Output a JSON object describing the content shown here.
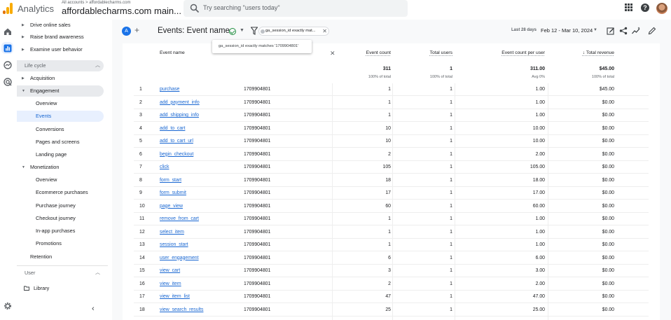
{
  "topbar": {
    "app_name": "Analytics",
    "account_breadcrumb": "All accounts > affordablecharms.com",
    "account_name": "affordablecharms.com main...",
    "search_placeholder": "Try searching \"users today\"",
    "icons": [
      "apps-grid-icon",
      "help-icon",
      "account-avatar"
    ]
  },
  "rail": {
    "icons": [
      "home-icon",
      "reports-icon",
      "explore-icon",
      "advertising-icon",
      "admin-gear-icon"
    ]
  },
  "sidebar": {
    "top_items": [
      "Drive online sales",
      "Raise brand awareness",
      "Examine user behavior"
    ],
    "lifecycle_label": "Life cycle",
    "acquisition": "Acquisition",
    "engagement": "Engagement",
    "engagement_children": [
      "Overview",
      "Events",
      "Conversions",
      "Pages and screens",
      "Landing page"
    ],
    "monetization": "Monetization",
    "monetization_children": [
      "Overview",
      "Ecommerce purchases",
      "Purchase journey",
      "Checkout journey",
      "In-app purchases",
      "Promotions"
    ],
    "retention": "Retention",
    "user_label": "User",
    "library": "Library",
    "collapse_icon": "chevron-left-icon"
  },
  "toolbar": {
    "avatar_letter": "A",
    "report_title": "Events: Event name",
    "filter_chip": "ga_session_id exactly mat...",
    "date_label": "Last 28 days",
    "date_range": "Feb 12 - Mar 10, 2024",
    "icons": [
      "customize-report-icon",
      "share-icon",
      "insights-icon",
      "edit-icon"
    ]
  },
  "tooltip": {
    "text": "ga_session_id exactly matches '1709904801'"
  },
  "table": {
    "headers": {
      "event_name": "Event name",
      "event_count": "Event count",
      "total_users": "Total users",
      "event_count_per_user": "Event count per user",
      "total_revenue": "↓ Total revenue"
    },
    "totals": {
      "event_count": "311",
      "event_count_sub": "100% of total",
      "total_users": "1",
      "total_users_sub": "100% of total",
      "per_user": "311.00",
      "per_user_sub": "Avg 0%",
      "revenue": "$45.00",
      "revenue_sub": "100% of total"
    },
    "rows": [
      {
        "idx": "1",
        "name": "purchase",
        "session": "1709904801",
        "count": "1",
        "users": "1",
        "per_user": "1.00",
        "revenue": "$45.00"
      },
      {
        "idx": "2",
        "name": "add_payment_info",
        "session": "1709904801",
        "count": "1",
        "users": "1",
        "per_user": "1.00",
        "revenue": "$0.00"
      },
      {
        "idx": "3",
        "name": "add_shipping_info",
        "session": "1709904801",
        "count": "1",
        "users": "1",
        "per_user": "1.00",
        "revenue": "$0.00"
      },
      {
        "idx": "4",
        "name": "add_to_cart",
        "session": "1709904801",
        "count": "10",
        "users": "1",
        "per_user": "10.00",
        "revenue": "$0.00"
      },
      {
        "idx": "5",
        "name": "add_to_cart_url",
        "session": "1709904801",
        "count": "10",
        "users": "1",
        "per_user": "10.00",
        "revenue": "$0.00"
      },
      {
        "idx": "6",
        "name": "begin_checkout",
        "session": "1709904801",
        "count": "2",
        "users": "1",
        "per_user": "2.00",
        "revenue": "$0.00"
      },
      {
        "idx": "7",
        "name": "click",
        "session": "1709904801",
        "count": "105",
        "users": "1",
        "per_user": "105.00",
        "revenue": "$0.00"
      },
      {
        "idx": "8",
        "name": "form_start",
        "session": "1709904801",
        "count": "18",
        "users": "1",
        "per_user": "18.00",
        "revenue": "$0.00"
      },
      {
        "idx": "9",
        "name": "form_submit",
        "session": "1709904801",
        "count": "17",
        "users": "1",
        "per_user": "17.00",
        "revenue": "$0.00"
      },
      {
        "idx": "10",
        "name": "page_view",
        "session": "1709904801",
        "count": "60",
        "users": "1",
        "per_user": "60.00",
        "revenue": "$0.00"
      },
      {
        "idx": "11",
        "name": "remove_from_cart",
        "session": "1709904801",
        "count": "1",
        "users": "1",
        "per_user": "1.00",
        "revenue": "$0.00"
      },
      {
        "idx": "12",
        "name": "select_item",
        "session": "1709904801",
        "count": "1",
        "users": "1",
        "per_user": "1.00",
        "revenue": "$0.00"
      },
      {
        "idx": "13",
        "name": "session_start",
        "session": "1709904801",
        "count": "1",
        "users": "1",
        "per_user": "1.00",
        "revenue": "$0.00"
      },
      {
        "idx": "14",
        "name": "user_engagement",
        "session": "1709904801",
        "count": "6",
        "users": "1",
        "per_user": "6.00",
        "revenue": "$0.00"
      },
      {
        "idx": "15",
        "name": "view_cart",
        "session": "1709904801",
        "count": "3",
        "users": "1",
        "per_user": "3.00",
        "revenue": "$0.00"
      },
      {
        "idx": "16",
        "name": "view_item",
        "session": "1709904801",
        "count": "2",
        "users": "1",
        "per_user": "2.00",
        "revenue": "$0.00"
      },
      {
        "idx": "17",
        "name": "view_item_list",
        "session": "1709904801",
        "count": "47",
        "users": "1",
        "per_user": "47.00",
        "revenue": "$0.00"
      },
      {
        "idx": "18",
        "name": "view_search_results",
        "session": "1709904801",
        "count": "25",
        "users": "1",
        "per_user": "25.00",
        "revenue": "$0.00"
      }
    ]
  },
  "colors": {
    "accent": "#1a73e8",
    "logo_orange": "#f9ab00",
    "logo_dark_orange": "#e37400",
    "link": "#1967d2",
    "selected_bg": "#e8f0fe"
  }
}
